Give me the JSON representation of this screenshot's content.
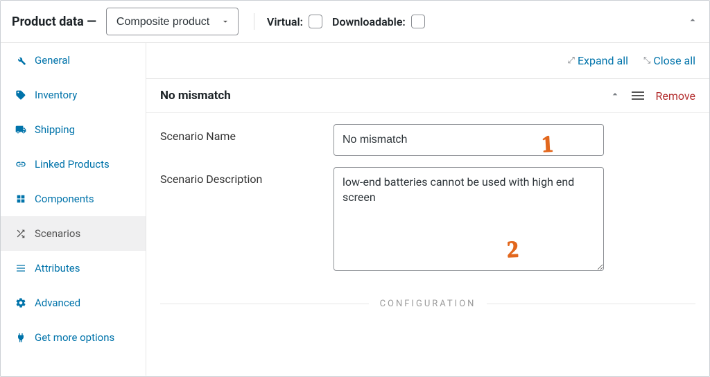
{
  "panel_title": "Product data —",
  "product_type": "Composite product",
  "virtual_label": "Virtual:",
  "downloadable_label": "Downloadable:",
  "sidebar": {
    "items": [
      {
        "label": "General",
        "icon": "wrench"
      },
      {
        "label": "Inventory",
        "icon": "tag"
      },
      {
        "label": "Shipping",
        "icon": "truck"
      },
      {
        "label": "Linked Products",
        "icon": "link"
      },
      {
        "label": "Components",
        "icon": "components"
      },
      {
        "label": "Scenarios",
        "icon": "shuffle"
      },
      {
        "label": "Attributes",
        "icon": "list"
      },
      {
        "label": "Advanced",
        "icon": "gear"
      },
      {
        "label": "Get more options",
        "icon": "plug"
      }
    ]
  },
  "toolbar": {
    "expand_all": "Expand all",
    "close_all": "Close all"
  },
  "scenario": {
    "title": "No mismatch",
    "remove": "Remove",
    "name_label": "Scenario Name",
    "name_value": "No mismatch",
    "desc_label": "Scenario Description",
    "desc_value": "low-end batteries cannot be used with high end screen",
    "config_heading": "CONFIGURATION"
  },
  "annotations": {
    "one": "1",
    "two": "2"
  }
}
